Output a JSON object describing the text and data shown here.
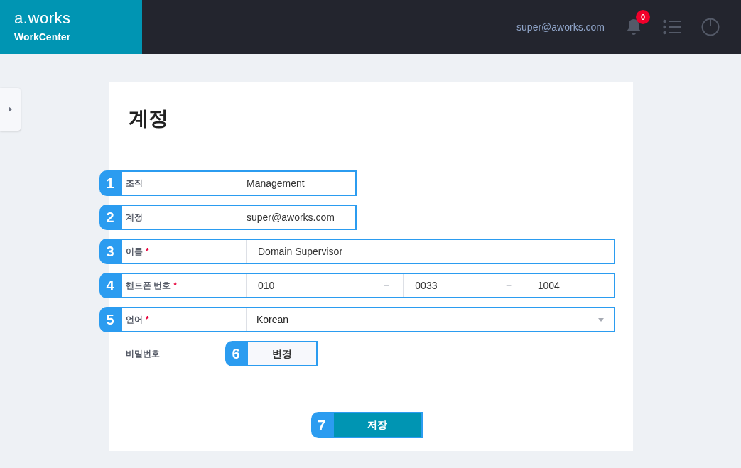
{
  "header": {
    "logo": "a.works",
    "product": "WorkCenter",
    "user_email": "super@aworks.com",
    "notification_count": "0"
  },
  "page": {
    "title": "계정"
  },
  "fields": [
    {
      "kind": "static",
      "callout": "1",
      "label": "조직",
      "value": "Management"
    },
    {
      "kind": "static",
      "callout": "2",
      "label": "계정",
      "value": "super@aworks.com"
    },
    {
      "kind": "text",
      "callout": "3",
      "label": "이름",
      "required_mark": "*",
      "value": "Domain Supervisor"
    },
    {
      "kind": "phone",
      "callout": "4",
      "label": "핸드폰 번호",
      "required_mark": "*",
      "parts": [
        "010",
        "0033",
        "1004"
      ],
      "separators": [
        "–",
        "–"
      ]
    },
    {
      "kind": "select",
      "callout": "5",
      "label": "언어",
      "required_mark": "*",
      "value": "Korean"
    }
  ],
  "password": {
    "label": "비밀번호",
    "callout": "6",
    "button": "변경"
  },
  "save": {
    "callout": "7",
    "button": "저장"
  }
}
